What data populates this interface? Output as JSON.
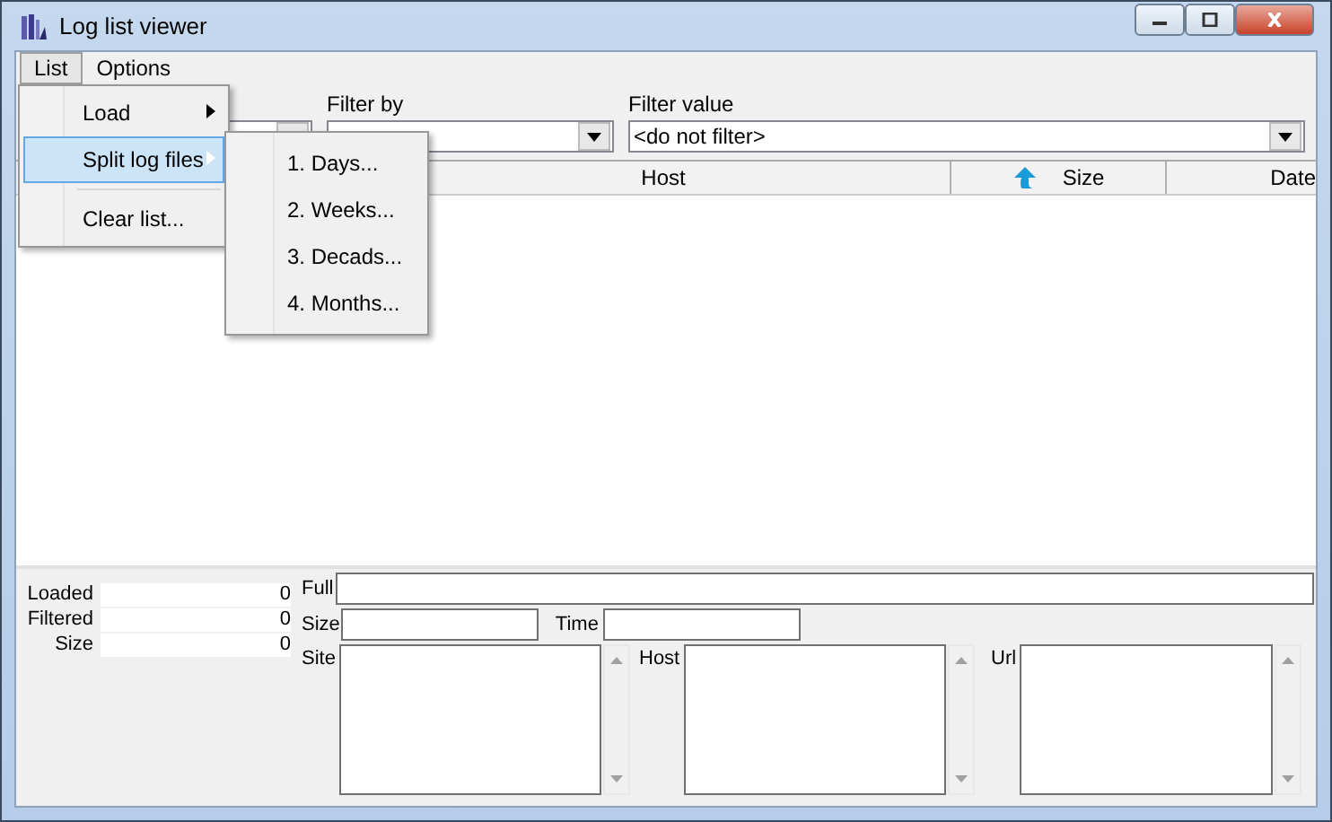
{
  "window": {
    "title": "Log list viewer"
  },
  "menu_bar": [
    {
      "label": "List",
      "selected": true
    },
    {
      "label": "Options",
      "selected": false
    }
  ],
  "list_menu": [
    {
      "kind": "submenu",
      "label": "Load",
      "selected": false
    },
    {
      "kind": "submenu",
      "label": "Split log files",
      "selected": true
    },
    {
      "kind": "separator"
    },
    {
      "kind": "item",
      "label": "Clear list...",
      "selected": false
    }
  ],
  "split_submenu": [
    {
      "label": "1. Days..."
    },
    {
      "label": "2. Weeks..."
    },
    {
      "label": "3. Decads..."
    },
    {
      "label": "4. Months..."
    }
  ],
  "filters": [
    {
      "label": "Filter by"
    },
    {
      "label": "Filter value",
      "value": "<do not filter>"
    }
  ],
  "table": {
    "columns": [
      {
        "label": "Host",
        "sorted": false
      },
      {
        "label": "Size",
        "sorted": true
      },
      {
        "label": "Date",
        "sorted": false
      }
    ]
  },
  "stats": [
    {
      "label": "Loaded",
      "value": "0"
    },
    {
      "label": "Filtered",
      "value": "0"
    },
    {
      "label": "Size",
      "value": "0"
    }
  ],
  "details": {
    "full": "Full",
    "size": "Size",
    "time": "Time",
    "boxes": [
      "Site",
      "Host",
      "Url"
    ]
  }
}
